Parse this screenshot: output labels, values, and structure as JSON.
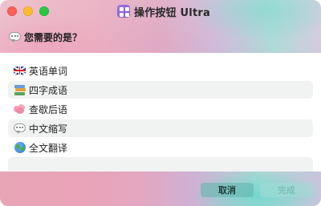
{
  "window": {
    "title": "操作按钮 Ultra",
    "app_icon": "grid-app-icon"
  },
  "prompt": {
    "icon": "speech-bubble-icon",
    "text": "您需要的是？"
  },
  "options": [
    {
      "icon": "uk-flag-icon",
      "label": "英语单词"
    },
    {
      "icon": "books-icon",
      "label": "四字成语"
    },
    {
      "icon": "brain-icon",
      "label": "查歇后语"
    },
    {
      "icon": "speech-bubble-icon",
      "label": "中文缩写"
    },
    {
      "icon": "globe-icon",
      "label": "全文翻译"
    }
  ],
  "footer": {
    "cancel_label": "取消",
    "done_label": "完成"
  },
  "colors": {
    "close": "#ff5f57",
    "minimize": "#febc2e",
    "maximize": "#28c840",
    "button_accent": "#60b2aa"
  }
}
